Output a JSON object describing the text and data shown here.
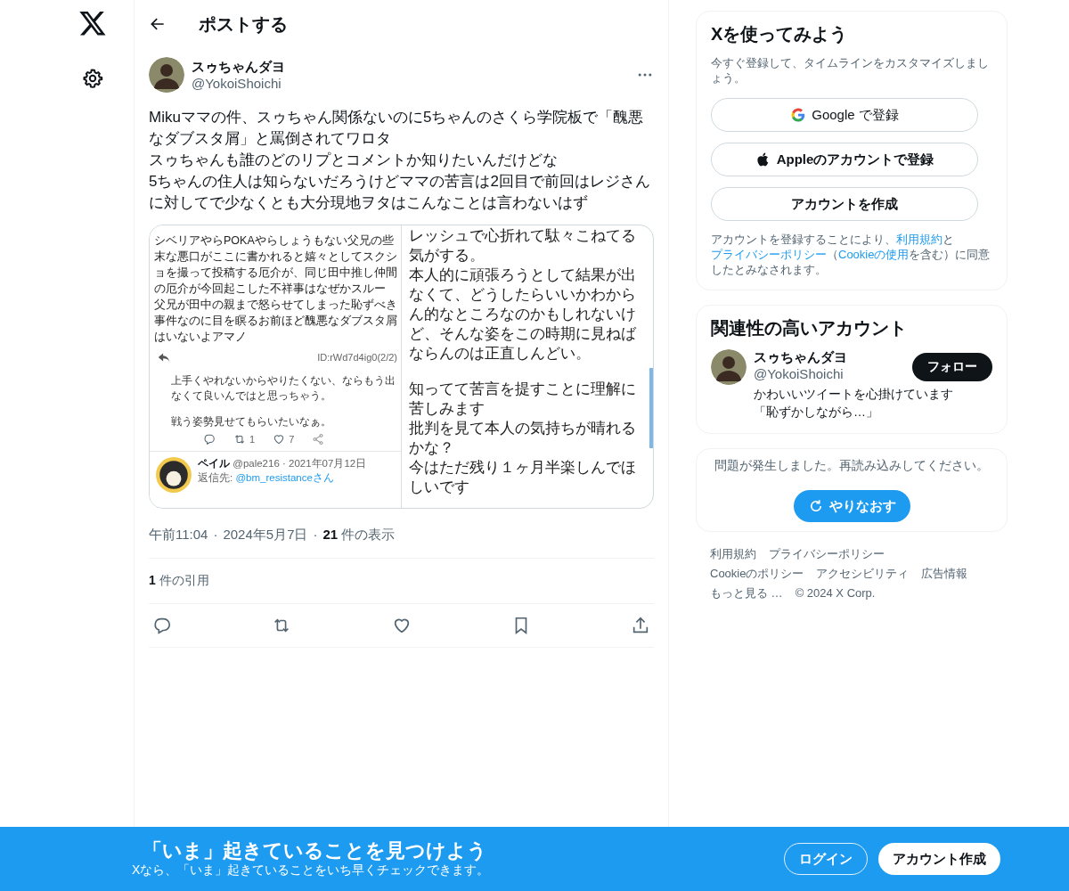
{
  "header": {
    "title": "ポストする"
  },
  "post": {
    "author": {
      "name": "スゥちゃんダヨ",
      "handle": "@YokoiShoichi"
    },
    "paragraphs": [
      "Mikuママの件、スゥちゃん関係ないのに5ちゃんのさくら学院板で「醜悪なダブスタ屑」と罵倒されてワロタ",
      "スゥちゃんも誰のどのリプとコメントか知りたいんだけどな",
      "5ちゃんの住人は知らないだろうけどママの苦言は2回目で前回はレジさんに対してで少なくとも大分現地ヲタはこんなことは言わないはず"
    ],
    "media": {
      "board_post": {
        "lines": [
          "シベリアやらPOKAやらしょうもない父兄の些末な悪口がここに書かれると嬉々としてスクショを撮って投稿する厄介が、同じ田中推し仲間の厄介が今回起こした不祥事はなぜかスルー",
          "父兄が田中の親まで怒らせてしまった恥ずべき事件なのに目を瞑るお前ほど醜悪なダブスタ屑はいないよアマノ"
        ],
        "id": "ID:rWd7d4ig0(2/2)"
      },
      "reply_snippet": {
        "lines": [
          "上手くやれないからやりたくない、ならもう出なくて良いんではと思っちゃう。",
          "戦う姿勢見せてもらいたいなぁ。"
        ],
        "retweets": "1",
        "likes": "7"
      },
      "quoted_reply": {
        "name": "ペイル",
        "meta": "@pale216 · 2021年07月12日",
        "reply_label": "返信先: ",
        "reply_to": "@bm_resistanceさん"
      },
      "right_top": {
        "lines": [
          "レッシュで心折れて駄々こねてる気がする。",
          "本人的に頑張ろうとして結果が出なくて、どうしたらいいかわからん的なところなのかもしれないけど、そんな姿をこの時期に見ねばならんのは正直しんどい。"
        ]
      },
      "right_bottom": {
        "lines": [
          "知ってて苦言を提すことに理解に苦しみます",
          "批判を見て本人の気持ちが晴れるかな？",
          "今はただ残り１ヶ月半楽しんでほしいです"
        ]
      }
    },
    "separator": "·",
    "time": "午前11:04",
    "date": "2024年5月7日",
    "views_count": "21",
    "views_label": "件の表示",
    "quotes_count": "1",
    "quotes_label": "件の引用"
  },
  "signup": {
    "title": "Xを使ってみよう",
    "subtitle": "今すぐ登録して、タイムラインをカスタマイズしましょう。",
    "buttons": [
      {
        "kind": "google",
        "label": "Google で登録"
      },
      {
        "kind": "apple",
        "label": "Appleのアカウントで登録"
      },
      {
        "kind": "plain",
        "label": "アカウントを作成"
      }
    ],
    "legal": [
      {
        "text": "アカウントを登録することにより、",
        "link": false
      },
      {
        "text": "利用規約",
        "link": true
      },
      {
        "text": "と",
        "link": false
      },
      {
        "text": "プライバシーポリシー",
        "link": true
      },
      {
        "text": "（",
        "link": false
      },
      {
        "text": "Cookieの使用",
        "link": true
      },
      {
        "text": "を含む）に同意したとみなされます。",
        "link": false
      }
    ]
  },
  "related": {
    "title": "関連性の高いアカウント",
    "name": "スゥちゃんダヨ",
    "handle": "@YokoiShoichi",
    "follow": "フォロー",
    "bio": "かわいいツイートを心掛けています「恥ずかしながら…」"
  },
  "error": {
    "message": "問題が発生しました。再読み込みしてください。",
    "retry": "やりなおす"
  },
  "footer": [
    "利用規約",
    "プライバシーポリシー",
    "Cookieのポリシー",
    "アクセシビリティ",
    "広告情報",
    "もっと見る …",
    "© 2024 X Corp."
  ],
  "banner": {
    "title": "「いま」起きていることを見つけよう",
    "subtitle": "Xなら、「いま」起きていることをいち早くチェックできます。",
    "login": "ログイン",
    "signup": "アカウント作成"
  }
}
